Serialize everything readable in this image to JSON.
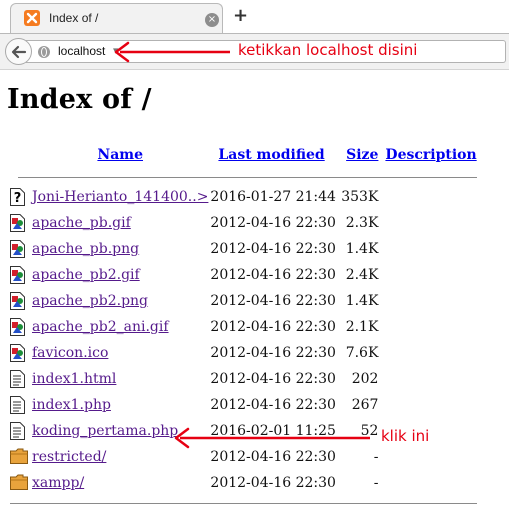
{
  "browser": {
    "tab_title": "Index of /",
    "tab_close": "×",
    "new_tab": "+",
    "url": "localhost"
  },
  "annotations": {
    "url_note": "ketikkan localhost disini",
    "file_note": "klik ini",
    "color": "#e60012"
  },
  "page": {
    "title": "Index of /",
    "columns": {
      "name": "Name",
      "modified": "Last modified",
      "size": "Size",
      "description": "Description"
    },
    "rows": [
      {
        "icon": "unknown-file-icon",
        "name": "Joni-Herianto_141400..>",
        "modified": "2016-01-27 21:44",
        "size": "353K",
        "description": ""
      },
      {
        "icon": "image-file-icon",
        "name": "apache_pb.gif",
        "modified": "2012-04-16 22:30",
        "size": "2.3K",
        "description": ""
      },
      {
        "icon": "image-file-icon",
        "name": "apache_pb.png",
        "modified": "2012-04-16 22:30",
        "size": "1.4K",
        "description": ""
      },
      {
        "icon": "image-file-icon",
        "name": "apache_pb2.gif",
        "modified": "2012-04-16 22:30",
        "size": "2.4K",
        "description": ""
      },
      {
        "icon": "image-file-icon",
        "name": "apache_pb2.png",
        "modified": "2012-04-16 22:30",
        "size": "1.4K",
        "description": ""
      },
      {
        "icon": "image-file-icon",
        "name": "apache_pb2_ani.gif",
        "modified": "2012-04-16 22:30",
        "size": "2.1K",
        "description": ""
      },
      {
        "icon": "image-file-icon",
        "name": "favicon.ico",
        "modified": "2012-04-16 22:30",
        "size": "7.6K",
        "description": ""
      },
      {
        "icon": "text-file-icon",
        "name": "index1.html",
        "modified": "2012-04-16 22:30",
        "size": "202",
        "description": ""
      },
      {
        "icon": "text-file-icon",
        "name": "index1.php",
        "modified": "2012-04-16 22:30",
        "size": "267",
        "description": ""
      },
      {
        "icon": "text-file-icon",
        "name": "koding_pertama.php",
        "modified": "2016-02-01 11:25",
        "size": "52",
        "description": ""
      },
      {
        "icon": "folder-icon",
        "name": "restricted/",
        "modified": "2012-04-16 22:30",
        "size": "-",
        "description": ""
      },
      {
        "icon": "folder-icon",
        "name": "xampp/",
        "modified": "2012-04-16 22:30",
        "size": "-",
        "description": ""
      }
    ]
  }
}
